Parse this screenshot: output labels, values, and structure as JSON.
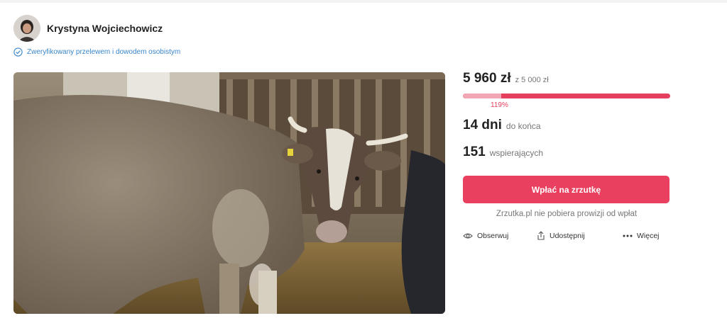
{
  "author": {
    "name": "Krystyna Wojciechowicz",
    "verified_text": "Zweryfikowany przelewem i dowodem osobistym"
  },
  "campaign": {
    "raised": "5 960 zł",
    "goal_text": "z 5 000 zł",
    "progress_fraction": 1.19,
    "percent_label": "119%",
    "days_value": "14 dni",
    "days_label": "do końca",
    "supporters_value": "151",
    "supporters_label": "wspierających",
    "donate_label": "Wpłać na zrzutkę",
    "no_fee_text": "Zrzutka.pl nie pobiera prowizji od wpłat"
  },
  "actions": {
    "follow_label": "Obserwuj",
    "share_label": "Udostępnij",
    "more_label": "Więcej"
  },
  "icons": {
    "verified": "check-circle-icon",
    "follow": "eye-icon",
    "share": "share-icon",
    "more": "more-dots-icon"
  },
  "colors": {
    "accent": "#e8405e",
    "progress_light": "#f3a6b4",
    "verified_blue": "#3a86c8"
  }
}
